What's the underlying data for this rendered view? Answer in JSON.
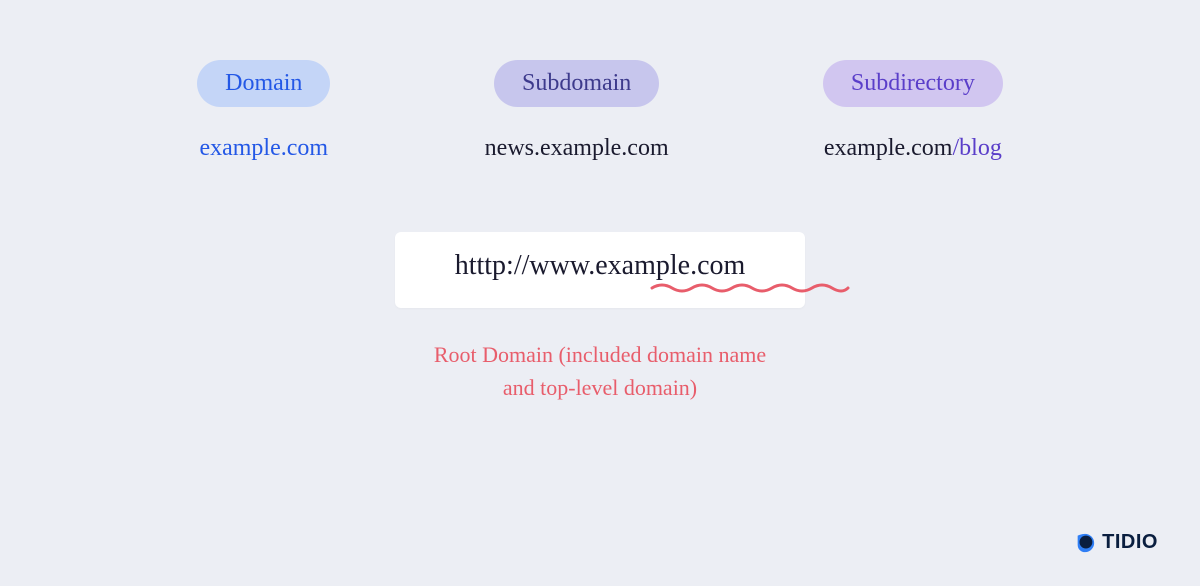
{
  "columns": [
    {
      "badge": "Domain",
      "example_prefix": "",
      "example_accent": "example.com",
      "example_suffix": "",
      "accent_class": "accent-blue"
    },
    {
      "badge": "Subdomain",
      "example_prefix": "news.",
      "example_accent": "",
      "example_suffix": "example.com",
      "accent_class": ""
    },
    {
      "badge": "Subdirectory",
      "example_prefix": "example.com",
      "example_accent": "/blog",
      "example_suffix": "",
      "accent_class": "accent-purple"
    }
  ],
  "url_box": {
    "text": "htttp://www.example.com"
  },
  "annotation": {
    "line1": "Root Domain (included domain name",
    "line2": "and top-level domain)"
  },
  "logo": {
    "text": "TIDIO"
  }
}
